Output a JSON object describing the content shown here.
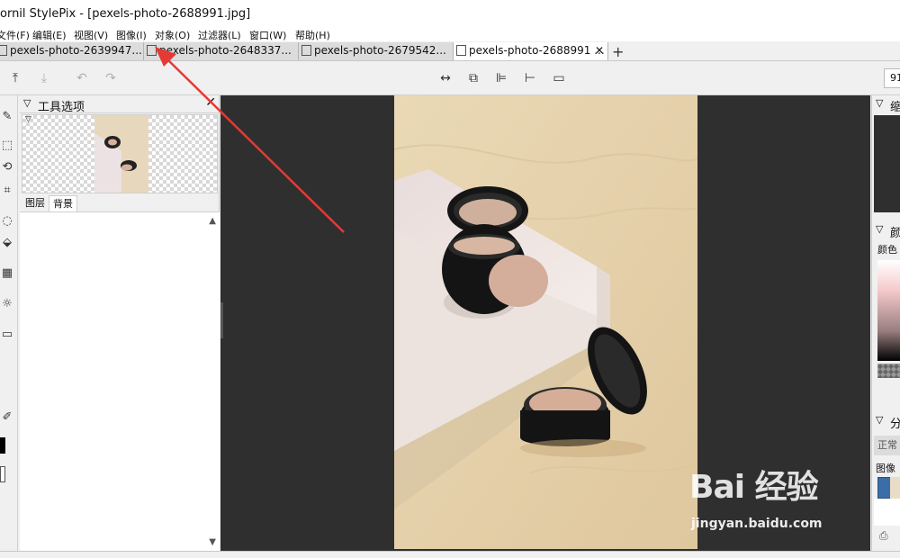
{
  "window": {
    "title": "ornil StylePix - [pexels-photo-2688991.jpg]"
  },
  "menu": [
    "文件(F)",
    "编辑(E)",
    "视图(V)",
    "图像(I)",
    "对象(O)",
    "过滤器(L)",
    "窗口(W)",
    "帮助(H)"
  ],
  "tabs": [
    {
      "label": "pexels-photo-2639947...",
      "active": false
    },
    {
      "label": "pexels-photo-2648337...",
      "active": false
    },
    {
      "label": "pexels-photo-2679542...",
      "active": false
    },
    {
      "label": "pexels-photo-2688991 ...",
      "active": true
    }
  ],
  "toolbar": {
    "zoom_value": "91"
  },
  "tool_panel": {
    "title": "工具选项",
    "layer_tabs": [
      "图层",
      "背景"
    ]
  },
  "right_panel": {
    "nav_title": "缩",
    "color_title": "颜",
    "color_label": "颜色",
    "layers_title": "分",
    "mode_value": "正常",
    "image_label": "图像"
  },
  "watermark": {
    "brand": "Bai 经验",
    "url": "jingyan.baidu.com"
  },
  "colors": {
    "canvas_bg": "#2f2f2f",
    "arrow": "#e53935",
    "panel_bg": "#f0f0f0"
  }
}
